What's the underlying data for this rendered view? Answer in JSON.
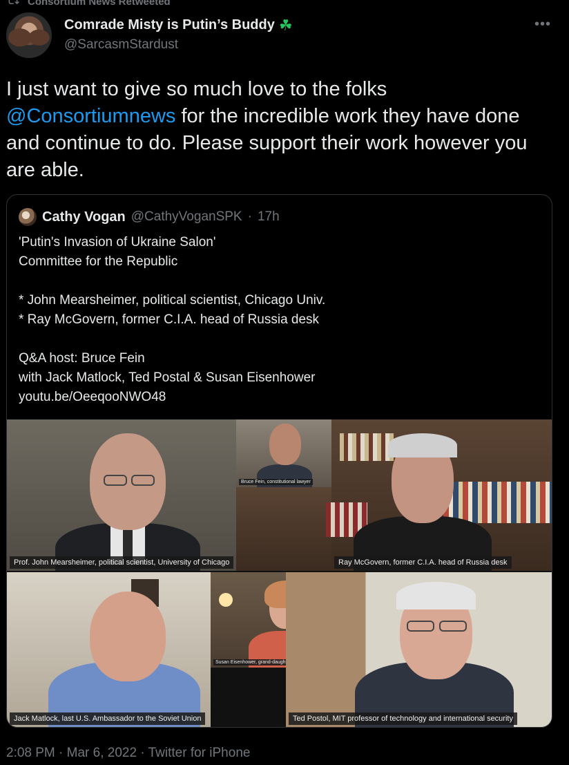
{
  "retweet": {
    "label": "Consortium News Retweeted"
  },
  "author": {
    "display_name": "Comrade Misty is Putin’s Buddy",
    "emoji": "☘",
    "handle": "@SarcasmStardust"
  },
  "more_icon": "more-horizontal-icon",
  "tweet": {
    "text_before": "I just want to give so much love to the folks ",
    "mention": "@Consortiumnews",
    "text_after": " for the incredible work they have done and continue to do. Please support their work however you are able."
  },
  "quoted": {
    "display_name": "Cathy Vogan",
    "handle": "@CathyVoganSPK",
    "separator": "·",
    "time": "17h",
    "body": "'Putin's Invasion of Ukraine Salon'\nCommittee for the Republic\n\n* John Mearsheimer, political scientist, Chicago Univ.\n* Ray McGovern, former C.I.A. head of Russia desk\n\nQ&A host: Bruce Fein\nwith Jack Matlock, Ted Postal & Susan Eisenhower\nyoutu.be/OeeqooNWO48"
  },
  "video": {
    "captions": {
      "mearsheimer": "Prof. John Mearsheimer,  political scientist, University of Chicago",
      "fein": "Bruce Fein, constitutional lawyer",
      "mcgovern": "Ray McGovern, former C.I.A. head of Russia desk",
      "matlock": "Jack Matlock, last U.S. Ambassador to the Soviet Union",
      "eisenhower": "Susan Eisenhower, grand-daughter of General Dwight D. Eisenhower",
      "postol": "Ted Postol,  MIT professor of technology and international security"
    }
  },
  "footer": {
    "time": "2:08 PM",
    "separator1": "·",
    "date": "Mar 6, 2022",
    "separator2": "·",
    "source": "Twitter for iPhone"
  }
}
